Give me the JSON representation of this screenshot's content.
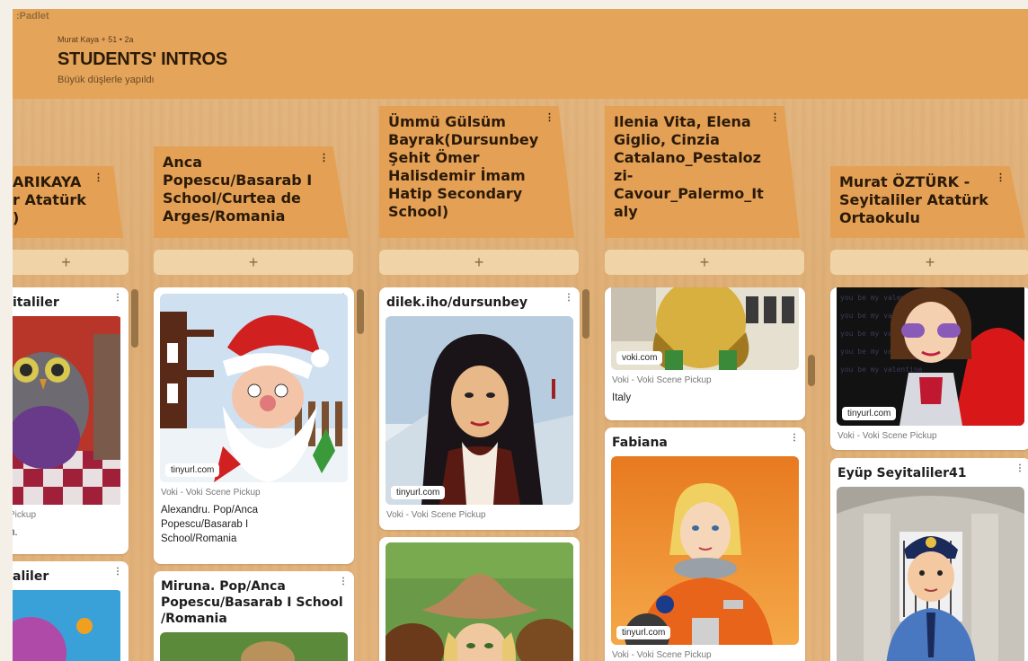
{
  "app": {
    "logo": ":Padlet"
  },
  "board": {
    "meta": "Murat Kaya + 51 •  2a",
    "title": "STUDENTS' INTROS",
    "subtitle": "Büyük düşlerle yapıldı"
  },
  "add_symbol": "+",
  "kebab": "⋮",
  "columns": [
    {
      "header": "ARIKAYA\nr Atatürk\n)"
    },
    {
      "header": "Anca\nPopescu/Basarab I\nSchool/Curtea de\nArges/Romania"
    },
    {
      "header": "Ümmü Gülsüm\nBayrak(Dursunbey\nŞehit Ömer\nHalisdemir İmam\nHatip Secondary\nSchool)"
    },
    {
      "header": "Ilenia Vita, Elena\nGiglio, Cinzia\nCatalano_Pestaloz\nzi-\nCavour_Palermo_It\naly"
    },
    {
      "header": "Murat ÖZTÜRK -\nSeyitaliler Atatürk\nOrtaokulu"
    }
  ],
  "cards": {
    "c0a": {
      "title": "italiler",
      "src": "Pickup",
      "desc": "n."
    },
    "c0b": {
      "title": "aliler"
    },
    "c1a": {
      "pill": "tinyurl.com",
      "src": "Voki - Voki Scene Pickup",
      "desc": "Alexandru. Pop/Anca\nPopescu/Basarab I\nSchool/Romania"
    },
    "c1b": {
      "title": "Miruna. Pop/Anca\nPopescu/Basarab I School\n/Romania"
    },
    "c2a": {
      "title": "dilek.iho/dursunbey",
      "pill": "tinyurl.com",
      "src": "Voki - Voki Scene Pickup"
    },
    "c3a": {
      "pill": "voki.com",
      "src": "Voki - Voki Scene Pickup",
      "desc": "Italy"
    },
    "c3b": {
      "title": "Fabiana",
      "pill": "tinyurl.com",
      "src": "Voki - Voki Scene Pickup"
    },
    "c4a": {
      "pill": "tinyurl.com",
      "src": "Voki - Voki Scene Pickup"
    },
    "c4b": {
      "title": "Eyüp Seyitaliler41"
    }
  },
  "colors": {
    "header_band": "#e4a45a",
    "column_header": "#e4a156",
    "add_bar": "#f0d3a6",
    "card": "#ffffff"
  }
}
